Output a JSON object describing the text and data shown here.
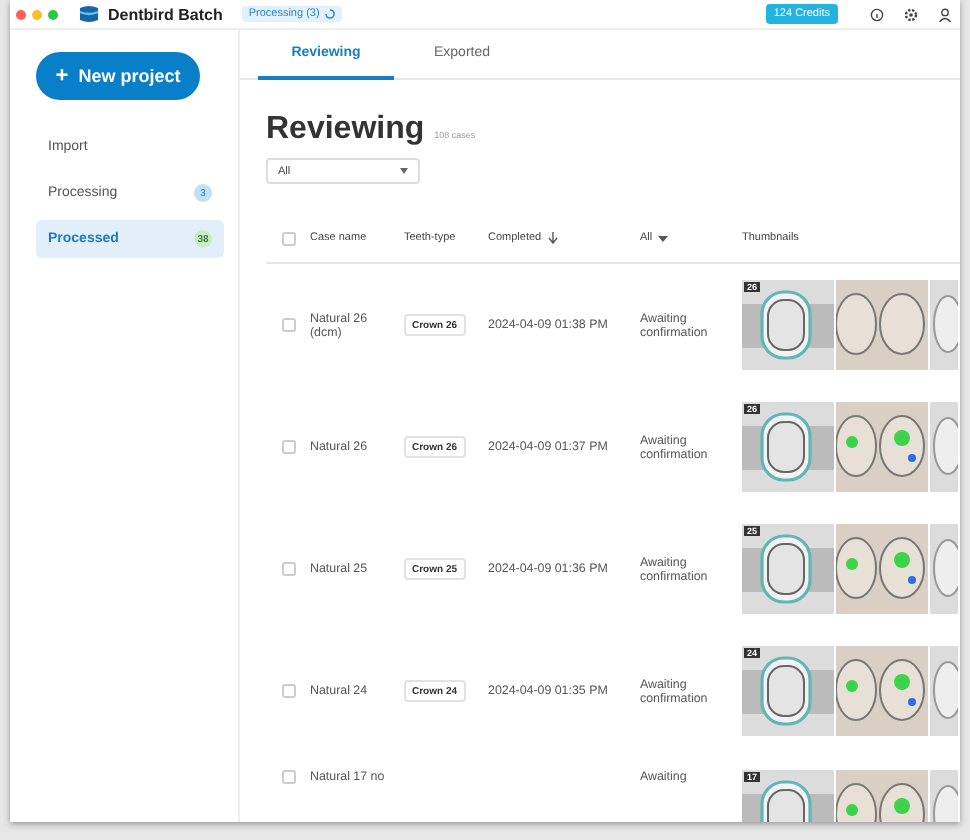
{
  "window": {
    "app_name": "Dentbird Batch",
    "processing_badge": "Processing (3)",
    "credits": "124 Credits"
  },
  "sidebar": {
    "new_project": "New project",
    "new_project_icon": "+",
    "items": [
      {
        "label": "Import",
        "selected": false
      },
      {
        "label": "Processing",
        "selected": false,
        "count": "3",
        "color": "#bfe0f5"
      },
      {
        "label": "Processed",
        "selected": true,
        "count": "38",
        "color": "#c9ecc4"
      }
    ]
  },
  "tabs": [
    {
      "label": "Reviewing",
      "selected": true
    },
    {
      "label": "Exported",
      "selected": false
    }
  ],
  "heading": {
    "title": "Reviewing",
    "count": "108 cases"
  },
  "filter": {
    "value": "All"
  },
  "table": {
    "select_all_checked": false,
    "columns": [
      {
        "label": "Case name",
        "kind": "plain"
      },
      {
        "label": "Teeth-type",
        "kind": "plain"
      },
      {
        "label": "Completed",
        "kind": "sort"
      },
      {
        "label": "All",
        "kind": "filter"
      },
      {
        "label": "Thumbnails",
        "kind": "plain"
      }
    ],
    "rows": [
      {
        "case_name": "Natural 26 (dcm)",
        "teeth_type": "Crown 26",
        "completed": "2024-04-09 01:38 PM",
        "status": "Awaiting confirmation",
        "tooth": "26",
        "checked": false
      },
      {
        "case_name": "Natural 26",
        "teeth_type": "Crown 26",
        "completed": "2024-04-09 01:37 PM",
        "status": "Awaiting confirmation",
        "tooth": "26",
        "checked": false
      },
      {
        "case_name": "Natural 25",
        "teeth_type": "Crown 25",
        "completed": "2024-04-09 01:36 PM",
        "status": "Awaiting confirmation",
        "tooth": "25",
        "checked": false
      },
      {
        "case_name": "Natural 24",
        "teeth_type": "Crown 24",
        "completed": "2024-04-09 01:35 PM",
        "status": "Awaiting confirmation",
        "tooth": "24",
        "checked": false
      },
      {
        "case_name": "Natural 17 no",
        "status": "Awaiting",
        "tooth": "17",
        "checked": false
      }
    ]
  }
}
